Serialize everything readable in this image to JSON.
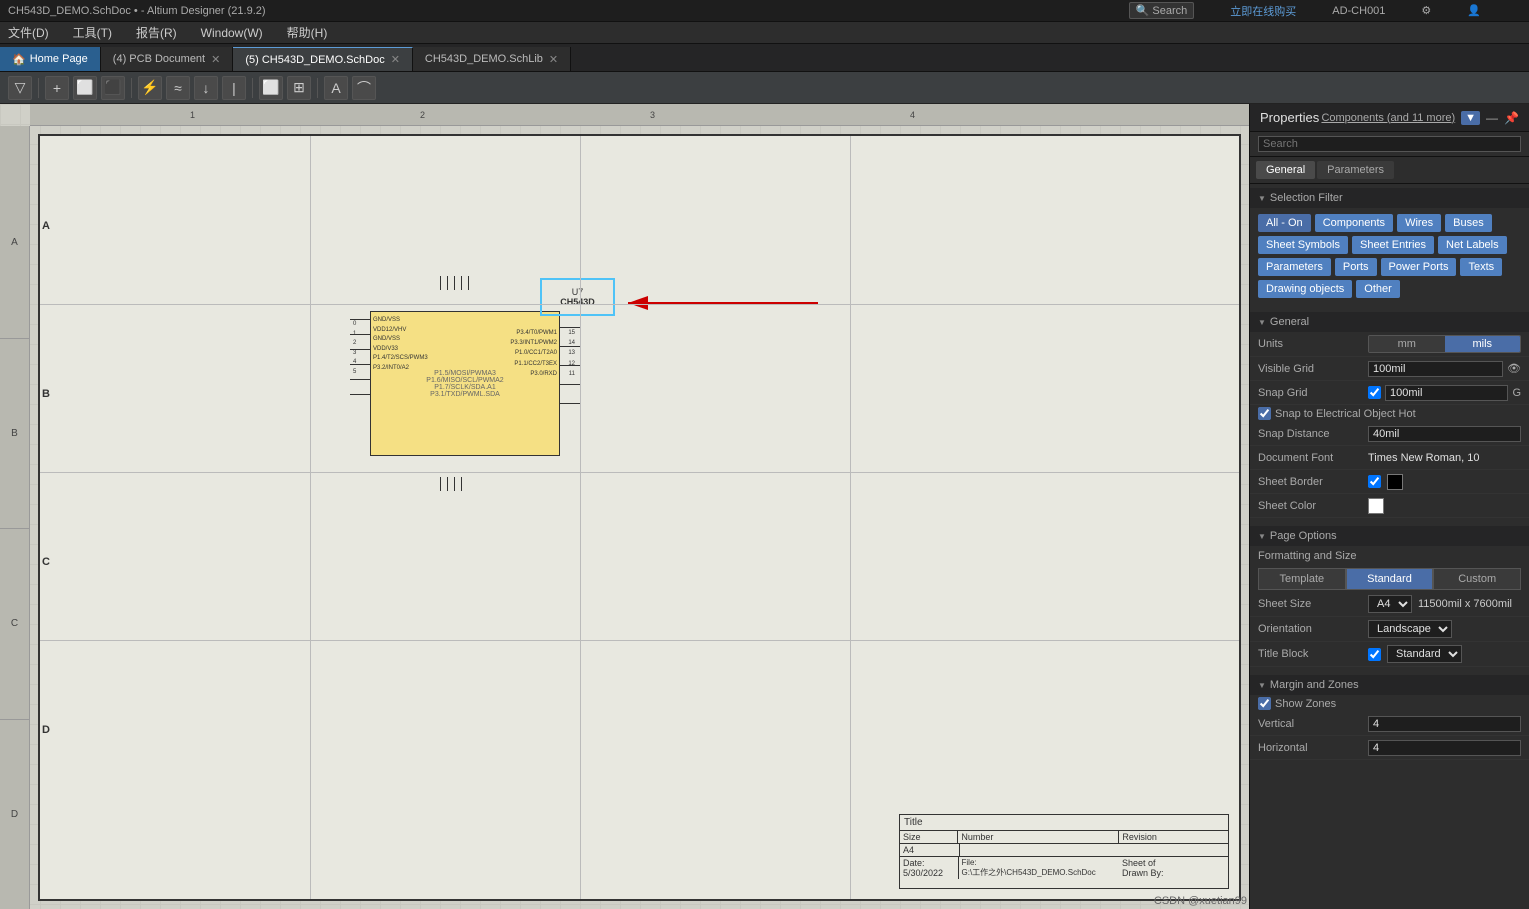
{
  "window": {
    "title": "CH543D_DEMO.SchDoc • - Altium Designer (21.9.2)",
    "menu": [
      "文件(D)",
      "工具(T)",
      "报告(R)",
      "Window(W)",
      "帮助(H)"
    ]
  },
  "toolbar_top": {
    "items": [
      "购买",
      "在线购买",
      "AD-CH001"
    ]
  },
  "tabs": [
    {
      "label": "Home Page",
      "icon": "🏠",
      "active": false
    },
    {
      "label": "(4) PCB Document",
      "active": false
    },
    {
      "label": "(5) CH543D_DEMO.SchDoc",
      "active": true,
      "modified": true
    },
    {
      "label": "CH543D_DEMO.SchLib",
      "active": false
    }
  ],
  "properties": {
    "title": "Properties",
    "filter_link": "Components (and 11 more)",
    "search_placeholder": "Search",
    "tabs": [
      "General",
      "Parameters"
    ],
    "selection_filter": {
      "header": "Selection Filter",
      "all_on": "All - On",
      "buttons": [
        "Components",
        "Wires",
        "Buses",
        "Sheet Symbols",
        "Sheet Entries",
        "Net Labels",
        "Parameters",
        "Ports",
        "Power Ports",
        "Texts",
        "Drawing objects",
        "Other"
      ]
    },
    "general": {
      "header": "General",
      "units_label": "Units",
      "units": [
        "mm",
        "mils"
      ],
      "active_unit": "mils",
      "fields": [
        {
          "label": "Visible Grid",
          "value": "100mil",
          "has_eye": true
        },
        {
          "label": "Snap Grid",
          "value": "100mil",
          "has_checkbox": true,
          "shortcut": "G"
        },
        {
          "label": "",
          "value": "Snap to Electrical Object Hot",
          "has_checkbox": true
        },
        {
          "label": "Snap Distance",
          "value": "40mil"
        },
        {
          "label": "Document Font",
          "value": "Times New Roman, 10"
        },
        {
          "label": "Sheet Border",
          "has_checkbox": true,
          "color": "#000000"
        },
        {
          "label": "Sheet Color",
          "color": "#ffffff"
        }
      ]
    },
    "page_options": {
      "header": "Page Options",
      "formatting_size": "Formatting and Size",
      "format_buttons": [
        "Template",
        "Standard",
        "Custom"
      ],
      "active_format": "Standard",
      "sheet_size_label": "Sheet Size",
      "sheet_size_value": "A4",
      "sheet_size_dims": "11500mil x 7600mil",
      "orientation_label": "Orientation",
      "orientation_value": "Landscape",
      "title_block_label": "Title Block",
      "title_block_value": "Standard",
      "title_block_checked": true
    },
    "margin_zones": {
      "header": "Margin and Zones",
      "show_zones_label": "Show Zones",
      "show_zones_checked": true,
      "vertical_label": "Vertical",
      "vertical_value": "4",
      "horizontal_label": "Horizontal",
      "horizontal_value": "4"
    }
  },
  "schematic": {
    "component": {
      "designator": "U7",
      "value": "CH543D",
      "pins_left": [
        "GND/VSS",
        "VDD12/VHV",
        "GND/VSS",
        "VDD/V33",
        "P1.4/T2/SCS/PWM3",
        "P3.2/INT0/A2"
      ],
      "pins_right": [
        "P3.4/T0/PWM1",
        "P3.3/INT1/PWM2",
        "P1.0/CC1/T2A0",
        "P1.1/CC2/T3EX",
        "P3.0/RXD"
      ],
      "pin_numbers_left": [
        "0",
        "1",
        "2",
        "3",
        "4",
        "5"
      ],
      "pin_numbers_right": [
        "15",
        "14",
        "13",
        "12",
        "11"
      ]
    },
    "title_block": {
      "title_label": "Title",
      "title_value": "",
      "size_label": "Size",
      "size_value": "A4",
      "number_label": "Number",
      "revision_label": "Revision",
      "date_label": "Date:",
      "date_value": "5/30/2022",
      "file_label": "File:",
      "file_value": "G:\\工作之外\\CH543D_DEMO.SchDoc",
      "sheet_label": "Sheet of",
      "drawn_by_label": "Drawn By:"
    },
    "rulers": {
      "cols": [
        "1",
        "2",
        "3",
        "4"
      ],
      "rows": [
        "A",
        "B",
        "C",
        "D"
      ]
    }
  },
  "watermark": "CSDN @xuetian99"
}
